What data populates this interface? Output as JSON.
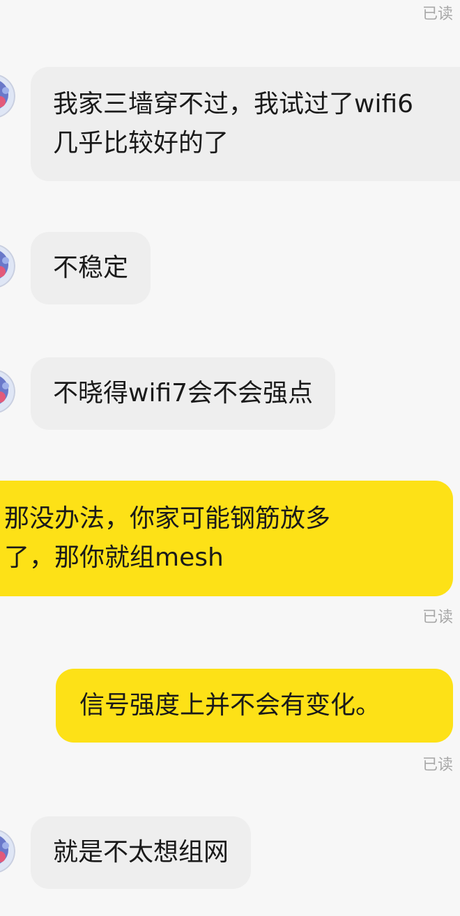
{
  "chat": {
    "messages": [
      {
        "direction": "incoming",
        "lines": [
          "我家三墙穿不过，我试过了wifi6",
          "几乎比较好的了"
        ]
      },
      {
        "direction": "incoming",
        "lines": [
          "不稳定"
        ]
      },
      {
        "direction": "incoming",
        "lines": [
          "不晓得wifi7会不会强点"
        ]
      },
      {
        "direction": "outgoing",
        "lines": [
          "那没办法，你家可能钢筋放多",
          "了，那你就组mesh"
        ],
        "status": "已读"
      },
      {
        "direction": "outgoing",
        "lines": [
          "信号强度上并不会有变化。"
        ],
        "status": "已读"
      },
      {
        "direction": "incoming",
        "lines": [
          "就是不太想组网"
        ]
      }
    ],
    "top_status": "已读"
  },
  "colors": {
    "background": "#f7f7f7",
    "incoming_bubble": "#eeeeee",
    "outgoing_bubble": "#fde117",
    "read_status": "#a8a8a8"
  },
  "icons": {
    "avatar": "contact-avatar-icon"
  }
}
